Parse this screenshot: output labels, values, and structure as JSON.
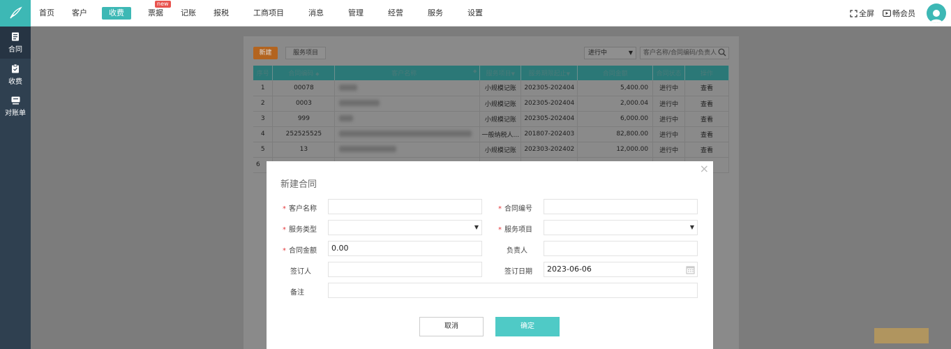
{
  "nav": {
    "items": [
      "首页",
      "客户",
      "收费",
      "票据",
      "记账",
      "报税",
      "工商项目",
      "消息",
      "管理",
      "经营",
      "服务",
      "设置"
    ],
    "badge_new": "new"
  },
  "top_right": {
    "fullscreen": "全屏",
    "member": "畅会员"
  },
  "sidebar": {
    "items": [
      "合同",
      "收费",
      "对账单"
    ]
  },
  "toolbar": {
    "new_button": "新建",
    "service_button": "服务项目",
    "status_value": "进行中",
    "search_placeholder": "客户名称/合同编码/负责人"
  },
  "table": {
    "headers": [
      "序号",
      "合同编码",
      "客户名称",
      "服务项目",
      "服务期限起止",
      "合同金额",
      "合同状态",
      "操作"
    ],
    "rows": [
      {
        "no": "1",
        "code": "00078",
        "service": "小规模记账",
        "period": "202305-202404",
        "amount": "5,400.00",
        "status": "进行中",
        "op": "查看"
      },
      {
        "no": "2",
        "code": "0003",
        "service": "小规模记账",
        "period": "202305-202404",
        "amount": "2,000.04",
        "status": "进行中",
        "op": "查看"
      },
      {
        "no": "3",
        "code": "999",
        "service": "小规模记账",
        "period": "202305-202404",
        "amount": "6,000.00",
        "status": "进行中",
        "op": "查看"
      },
      {
        "no": "4",
        "code": "252525525",
        "service": "一般纳税人...",
        "period": "201807-202403",
        "amount": "82,800.00",
        "status": "进行中",
        "op": "查看"
      },
      {
        "no": "5",
        "code": "13",
        "service": "小规模记账",
        "period": "202303-202402",
        "amount": "12,000.00",
        "status": "进行中",
        "op": "查看"
      },
      {
        "no": "6",
        "code": "",
        "service": "",
        "period": "",
        "amount": "",
        "status": "",
        "op": ""
      }
    ]
  },
  "modal": {
    "title": "新建合同",
    "required_mark": "*",
    "customer_name_label": "客户名称",
    "contract_no_label": "合同编号",
    "service_type_label": "服务类型",
    "service_item_label": "服务项目",
    "amount_label": "合同金额",
    "amount_value": "0.00",
    "owner_label": "负责人",
    "signer_label": "签订人",
    "sign_date_label": "签订日期",
    "sign_date_value": "2023-06-06",
    "remark_label": "备注",
    "cancel_label": "取消",
    "confirm_label": "确定"
  }
}
